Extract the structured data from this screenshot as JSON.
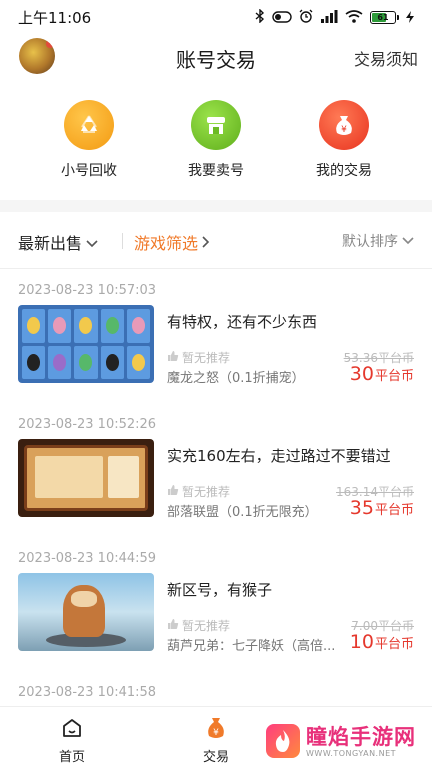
{
  "status_bar": {
    "time": "上午11:06",
    "battery_level": "61"
  },
  "header": {
    "title": "账号交易",
    "notice_link": "交易须知"
  },
  "shortcuts": [
    {
      "label": "小号回收",
      "icon": "recycle-icon",
      "color": "#f7a21e"
    },
    {
      "label": "我要卖号",
      "icon": "shop-icon",
      "color": "#7bc62d"
    },
    {
      "label": "我的交易",
      "icon": "money-bag-icon",
      "color": "#f0432c"
    }
  ],
  "filters": {
    "latest": "最新出售",
    "game_filter": "游戏筛选",
    "sort": "默认排序"
  },
  "listings": [
    {
      "time": "2023-08-23 10:57:03",
      "title": "有特权，还有不少东西",
      "recommend": "暂无推荐",
      "game": "魔龙之怒（0.1折捕宠）",
      "original_price": "53.36平台币",
      "price": "30",
      "price_unit": "平台币"
    },
    {
      "time": "2023-08-23 10:52:26",
      "title": "实充160左右，走过路过不要错过",
      "recommend": "暂无推荐",
      "game": "部落联盟（0.1折无限充）",
      "original_price": "163.14平台币",
      "price": "35",
      "price_unit": "平台币"
    },
    {
      "time": "2023-08-23 10:44:59",
      "title": "新区号，有猴子",
      "recommend": "暂无推荐",
      "game": "葫芦兄弟：七子降妖（高倍...",
      "original_price": "7.00平台币",
      "price": "10",
      "price_unit": "平台币"
    },
    {
      "time": "2023-08-23 10:41:58"
    }
  ],
  "bottom_nav": [
    {
      "label": "首页",
      "icon": "home-icon"
    },
    {
      "label": "交易",
      "icon": "trade-icon",
      "accent": "#f07a2a"
    }
  ],
  "watermark": {
    "main": "瞳焰手游网",
    "sub": "WWW.TONGYAN.NET"
  },
  "colors": {
    "accent": "#f07a2a",
    "price": "#e5382d"
  }
}
